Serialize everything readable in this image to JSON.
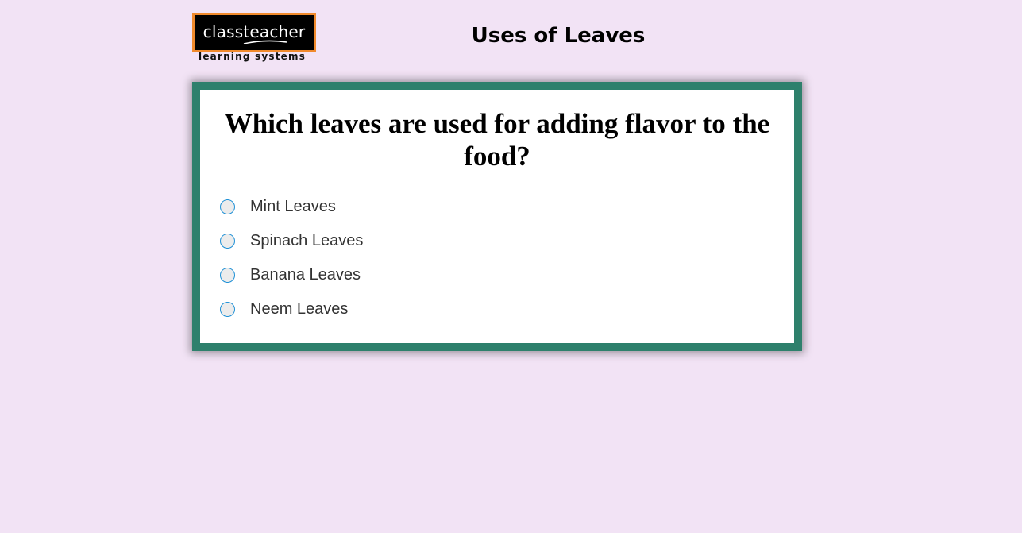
{
  "logo": {
    "wordmark": "classteacher",
    "tagline": "learning systems",
    "colors": {
      "background": "#000000",
      "border": "#f08a2c",
      "text": "#ffffff"
    }
  },
  "page": {
    "title": "Uses of Leaves",
    "background_color": "#f2e3f5"
  },
  "quiz": {
    "frame_color": "#2e806c",
    "question": "Which leaves are used for adding flavor to the food?",
    "options": [
      {
        "label": "Mint Leaves",
        "selected": false
      },
      {
        "label": "Spinach Leaves",
        "selected": false
      },
      {
        "label": "Banana Leaves",
        "selected": false
      },
      {
        "label": "Neem Leaves",
        "selected": false
      }
    ]
  }
}
